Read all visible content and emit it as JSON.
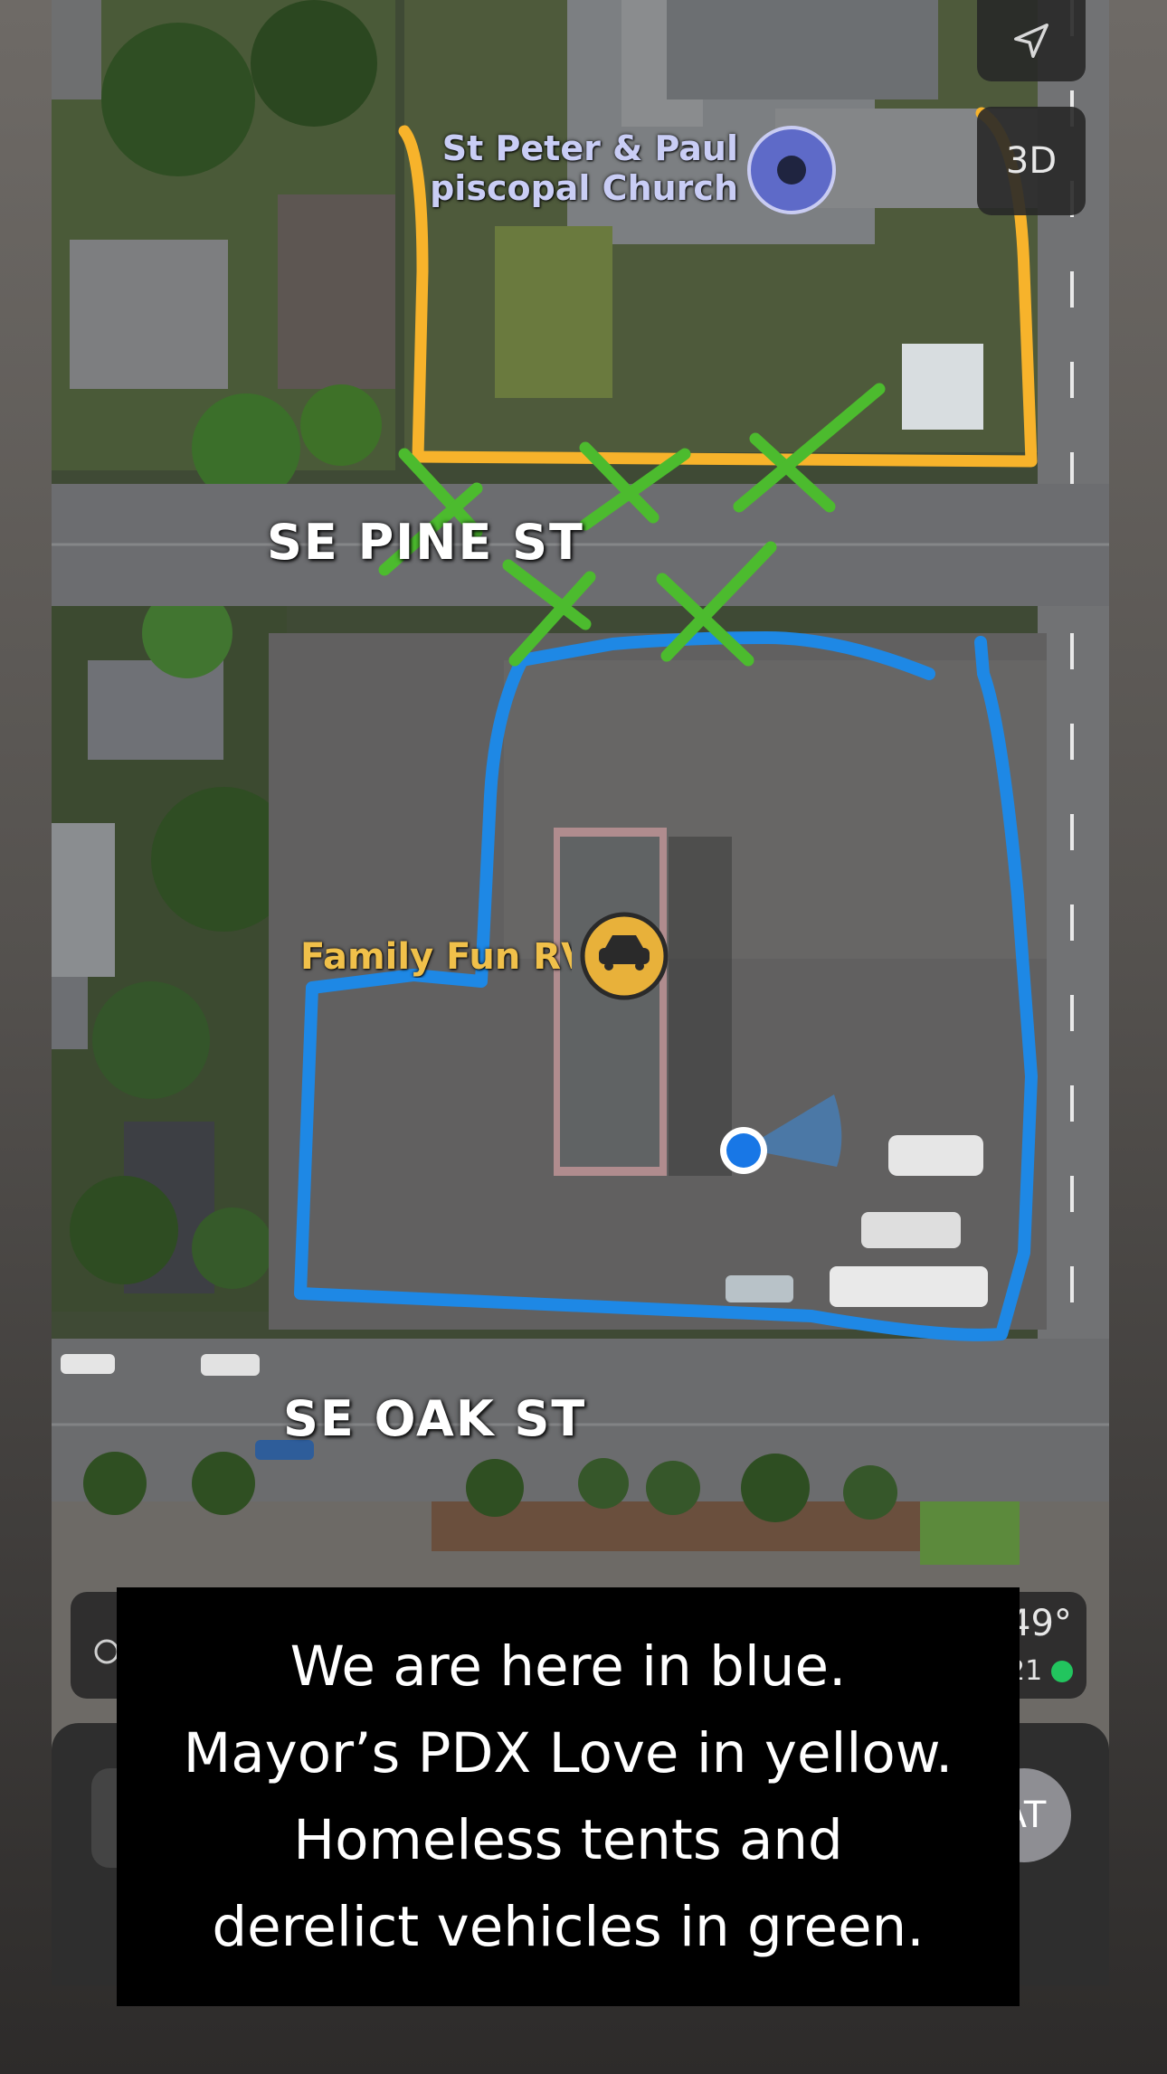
{
  "map": {
    "streets": {
      "pine": "SE PINE ST",
      "oak": "SE OAK ST"
    },
    "pois": {
      "church_line1": "St Peter & Paul",
      "church_line2": "piscopal Church",
      "rv_label": "Family Fun RV"
    },
    "icons": {
      "church": "place-of-worship-icon",
      "rv": "car-icon",
      "location": "current-location-icon"
    }
  },
  "controls": {
    "locate_icon": "location-arrow-icon",
    "view_3d_label": "3D"
  },
  "weather": {
    "temperature": "49°",
    "aqi": "21",
    "aqi_color": "#22c55e"
  },
  "profile": {
    "initials": "AT"
  },
  "annotations": {
    "colors": {
      "user_area": "#1e88e5",
      "pdx_love_area": "#f7b32b",
      "encampments": "#4cbb2e"
    }
  },
  "caption": {
    "lines": [
      "We are here in blue.",
      "Mayor’s PDX Love in yellow.",
      "Homeless tents and",
      "derelict vehicles in green."
    ]
  }
}
